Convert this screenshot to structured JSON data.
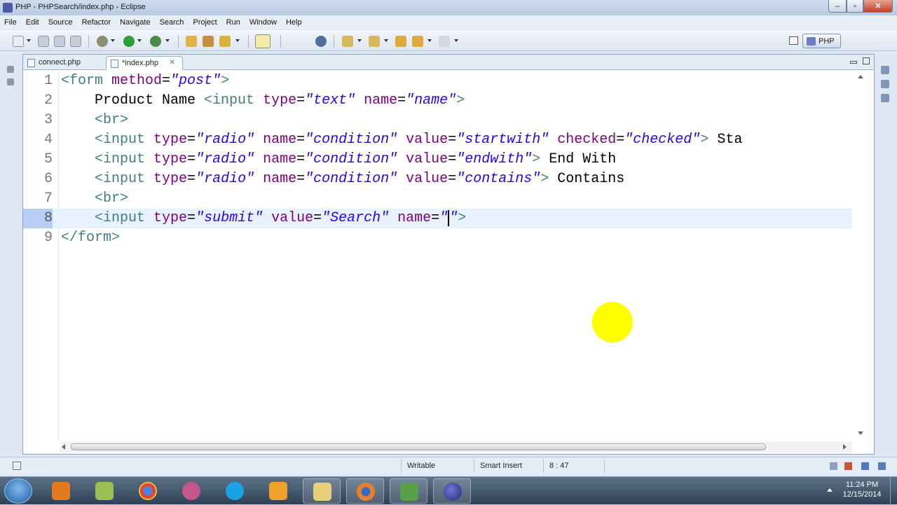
{
  "window": {
    "title": "PHP - PHPSearch/index.php - Eclipse",
    "controls": {
      "minimize": "–",
      "maximize": "▫",
      "close": "✕"
    }
  },
  "menubar": [
    "File",
    "Edit",
    "Source",
    "Refactor",
    "Navigate",
    "Search",
    "Project",
    "Run",
    "Window",
    "Help"
  ],
  "toolbar": {
    "perspective_label": "PHP",
    "icons": [
      "new-icon",
      "save-icon",
      "save-all-icon",
      "print-icon",
      "debug-icon",
      "run-icon",
      "search-icon",
      "open-type-icon",
      "open-resource-icon",
      "mark-occurrences-icon",
      "globe-icon",
      "next-annotation-icon",
      "prev-annotation-icon",
      "last-edit-icon",
      "back-icon",
      "forward-icon"
    ]
  },
  "editor": {
    "tabs": [
      {
        "label": "connect.php",
        "active": false,
        "dirty": false
      },
      {
        "label": "*index.php",
        "active": true,
        "dirty": true,
        "close": "✕"
      }
    ],
    "current_line": 8,
    "lines": [
      {
        "n": "1",
        "tokens": [
          {
            "t": "tag",
            "v": "<form "
          },
          {
            "t": "att",
            "v": "method"
          },
          {
            "t": "txt",
            "v": "="
          },
          {
            "t": "val",
            "v": "\"post\""
          },
          {
            "t": "tag",
            "v": ">"
          }
        ]
      },
      {
        "n": "2",
        "tokens": [
          {
            "t": "txt",
            "v": "    Product Name "
          },
          {
            "t": "tag",
            "v": "<input "
          },
          {
            "t": "att",
            "v": "type"
          },
          {
            "t": "txt",
            "v": "="
          },
          {
            "t": "val",
            "v": "\"text\""
          },
          {
            "t": "txt",
            "v": " "
          },
          {
            "t": "att",
            "v": "name"
          },
          {
            "t": "txt",
            "v": "="
          },
          {
            "t": "val",
            "v": "\"name\""
          },
          {
            "t": "tag",
            "v": ">"
          }
        ]
      },
      {
        "n": "3",
        "tokens": [
          {
            "t": "txt",
            "v": "    "
          },
          {
            "t": "tag",
            "v": "<br>"
          }
        ]
      },
      {
        "n": "4",
        "tokens": [
          {
            "t": "txt",
            "v": "    "
          },
          {
            "t": "tag",
            "v": "<input "
          },
          {
            "t": "att",
            "v": "type"
          },
          {
            "t": "txt",
            "v": "="
          },
          {
            "t": "val",
            "v": "\"radio\""
          },
          {
            "t": "txt",
            "v": " "
          },
          {
            "t": "att",
            "v": "name"
          },
          {
            "t": "txt",
            "v": "="
          },
          {
            "t": "val",
            "v": "\"condition\""
          },
          {
            "t": "txt",
            "v": " "
          },
          {
            "t": "att",
            "v": "value"
          },
          {
            "t": "txt",
            "v": "="
          },
          {
            "t": "val",
            "v": "\"startwith\""
          },
          {
            "t": "txt",
            "v": " "
          },
          {
            "t": "att",
            "v": "checked"
          },
          {
            "t": "txt",
            "v": "="
          },
          {
            "t": "val",
            "v": "\"checked\""
          },
          {
            "t": "tag",
            "v": ">"
          },
          {
            "t": "txt",
            "v": " Sta"
          }
        ]
      },
      {
        "n": "5",
        "tokens": [
          {
            "t": "txt",
            "v": "    "
          },
          {
            "t": "tag",
            "v": "<input "
          },
          {
            "t": "att",
            "v": "type"
          },
          {
            "t": "txt",
            "v": "="
          },
          {
            "t": "val",
            "v": "\"radio\""
          },
          {
            "t": "txt",
            "v": " "
          },
          {
            "t": "att",
            "v": "name"
          },
          {
            "t": "txt",
            "v": "="
          },
          {
            "t": "val",
            "v": "\"condition\""
          },
          {
            "t": "txt",
            "v": " "
          },
          {
            "t": "att",
            "v": "value"
          },
          {
            "t": "txt",
            "v": "="
          },
          {
            "t": "val",
            "v": "\"endwith\""
          },
          {
            "t": "tag",
            "v": ">"
          },
          {
            "t": "txt",
            "v": " End With"
          }
        ]
      },
      {
        "n": "6",
        "tokens": [
          {
            "t": "txt",
            "v": "    "
          },
          {
            "t": "tag",
            "v": "<input "
          },
          {
            "t": "att",
            "v": "type"
          },
          {
            "t": "txt",
            "v": "="
          },
          {
            "t": "val",
            "v": "\"radio\""
          },
          {
            "t": "txt",
            "v": " "
          },
          {
            "t": "att",
            "v": "name"
          },
          {
            "t": "txt",
            "v": "="
          },
          {
            "t": "val",
            "v": "\"condition\""
          },
          {
            "t": "txt",
            "v": " "
          },
          {
            "t": "att",
            "v": "value"
          },
          {
            "t": "txt",
            "v": "="
          },
          {
            "t": "val",
            "v": "\"contains\""
          },
          {
            "t": "tag",
            "v": ">"
          },
          {
            "t": "txt",
            "v": " Contains"
          }
        ]
      },
      {
        "n": "7",
        "tokens": [
          {
            "t": "txt",
            "v": "    "
          },
          {
            "t": "tag",
            "v": "<br>"
          }
        ]
      },
      {
        "n": "8",
        "tokens": [
          {
            "t": "txt",
            "v": "    "
          },
          {
            "t": "tag",
            "v": "<input "
          },
          {
            "t": "att",
            "v": "type"
          },
          {
            "t": "txt",
            "v": "="
          },
          {
            "t": "val",
            "v": "\"submit\""
          },
          {
            "t": "txt",
            "v": " "
          },
          {
            "t": "att",
            "v": "value"
          },
          {
            "t": "txt",
            "v": "="
          },
          {
            "t": "val",
            "v": "\"Search\""
          },
          {
            "t": "txt",
            "v": " "
          },
          {
            "t": "att",
            "v": "name"
          },
          {
            "t": "txt",
            "v": "="
          },
          {
            "t": "val",
            "v": "\""
          },
          {
            "t": "caret",
            "v": ""
          },
          {
            "t": "val",
            "v": "\""
          },
          {
            "t": "tag",
            "v": ">"
          }
        ]
      },
      {
        "n": "9",
        "tokens": [
          {
            "t": "tag",
            "v": "</form>"
          }
        ]
      }
    ]
  },
  "status": {
    "writable": "Writable",
    "insert_mode": "Smart Insert",
    "position": "8 : 47"
  },
  "taskbar": {
    "apps": [
      "media-player-icon",
      "file-manager-icon",
      "chrome-icon",
      "messenger-icon",
      "skype-icon",
      "outlook-icon",
      "explorer-icon",
      "firefox-icon",
      "task-manager-icon",
      "eclipse-icon"
    ],
    "time": "11:24 PM",
    "date": "12/15/2014"
  },
  "colors": {
    "tag": "#3f7f7f",
    "attribute": "#7f007f",
    "value": "#2a00ff",
    "current_line": "#e8f2fe",
    "cursor_highlight": "#ffff00"
  }
}
